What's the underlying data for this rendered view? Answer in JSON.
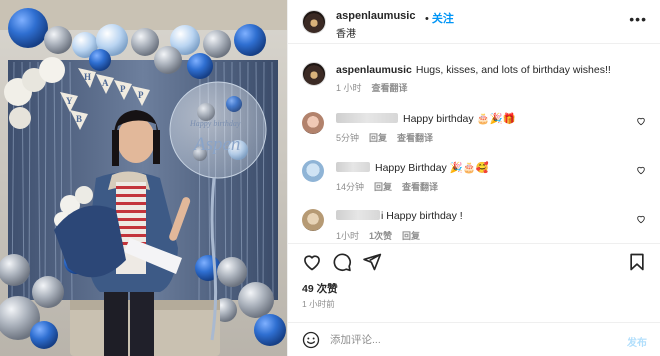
{
  "header": {
    "username": "aspenlaumusic",
    "separator": "•",
    "follow_label": "关注",
    "location": "香港",
    "more_icon": "more-horizontal-icon"
  },
  "photo": {
    "banner_letters": [
      "H",
      "A",
      "P",
      "P",
      "Y",
      "B",
      "I",
      "R"
    ],
    "balloon_text": "Aspen",
    "balloon_arc_text": "Happy birthday"
  },
  "caption": {
    "username": "aspenlaumusic",
    "text": "Hugs, kisses, and lots of birthday wishes!!",
    "time": "1 小时",
    "see_translation": "查看翻译"
  },
  "comments": [
    {
      "text": "Happy birthday 🎂🎉🎁",
      "time": "5分钟",
      "reply": "回复",
      "see_translation": "查看翻译"
    },
    {
      "text": "Happy Birthday 🎉🎂🥰",
      "time": "14分钟",
      "reply": "回复",
      "see_translation": "查看翻译"
    },
    {
      "text": "i Happy birthday !",
      "time": "1小时",
      "reply": "1次赞",
      "see_translation": "回复"
    }
  ],
  "actions": {
    "like_icon": "heart-icon",
    "comment_icon": "comment-icon",
    "share_icon": "share-icon",
    "save_icon": "bookmark-icon"
  },
  "likes": "49 次赞",
  "post_time": "1 小时前",
  "add_comment": {
    "emoji_icon": "smiley-icon",
    "placeholder": "添加评论...",
    "post_label": "发布"
  },
  "colors": {
    "link_blue": "#0095f6",
    "post_disabled": "#b2dffc",
    "secondary_text": "#8e8e8e",
    "balloon_blue": "#2f6fd1",
    "balloon_silver": "#b8bec7",
    "curtain": "#5c6f8c"
  }
}
